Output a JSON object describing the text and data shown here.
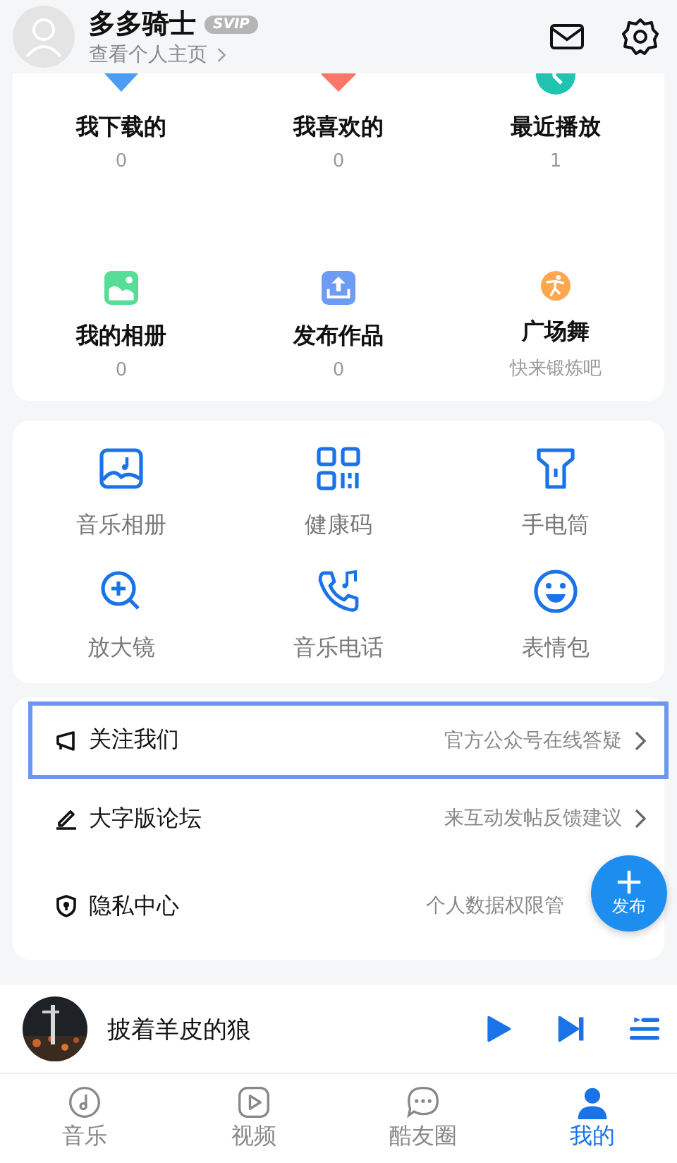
{
  "profile": {
    "name": "多多骑士",
    "badge": "SVIP",
    "link": "查看个人主页"
  },
  "stats": [
    {
      "kind": "download",
      "label": "我下载的",
      "value": "0"
    },
    {
      "kind": "heart",
      "label": "我喜欢的",
      "value": "0"
    },
    {
      "kind": "clock",
      "label": "最近播放",
      "value": "1"
    },
    {
      "kind": "album",
      "label": "我的相册",
      "value": "0"
    },
    {
      "kind": "upload",
      "label": "发布作品",
      "value": "0"
    },
    {
      "kind": "dance",
      "label": "广场舞",
      "value": "快来锻炼吧"
    }
  ],
  "tools": [
    {
      "kind": "music-album",
      "label": "音乐相册"
    },
    {
      "kind": "qr",
      "label": "健康码"
    },
    {
      "kind": "flashlight",
      "label": "手电筒"
    },
    {
      "kind": "magnifier",
      "label": "放大镜"
    },
    {
      "kind": "phone",
      "label": "音乐电话"
    },
    {
      "kind": "smile",
      "label": "表情包"
    }
  ],
  "rows": [
    {
      "kind": "megaphone",
      "label": "关注我们",
      "hint": "官方公众号在线答疑",
      "selected": true,
      "chevron": true
    },
    {
      "kind": "pen",
      "label": "大字版论坛",
      "hint": "来互动发帖反馈建议",
      "selected": false,
      "chevron": true
    },
    {
      "kind": "shield",
      "label": "隐私中心",
      "hint": "个人数据权限管",
      "selected": false,
      "chevron": false
    }
  ],
  "fab": {
    "label": "发布"
  },
  "player": {
    "title": "披着羊皮的狼"
  },
  "tabs": [
    {
      "kind": "music",
      "label": "音乐",
      "selected": false
    },
    {
      "kind": "video",
      "label": "视频",
      "selected": false
    },
    {
      "kind": "chat",
      "label": "酷友圈",
      "selected": false
    },
    {
      "kind": "me",
      "label": "我的",
      "selected": true
    }
  ]
}
